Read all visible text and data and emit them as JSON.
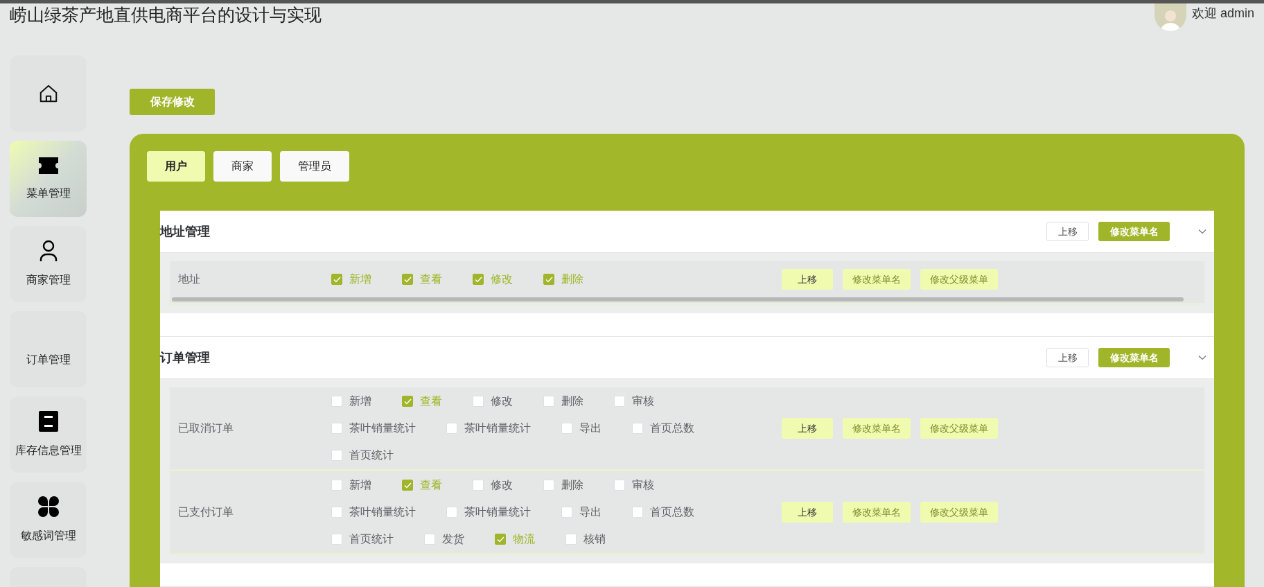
{
  "header": {
    "title": "崂山绿茶产地直供电商平台的设计与实现",
    "greeting": "欢迎 admin"
  },
  "sidebar": {
    "items": [
      {
        "kind": "home",
        "selected": false
      },
      {
        "kind": "ticket",
        "label": "菜单管理",
        "selected": true
      },
      {
        "kind": "person",
        "label": "商家管理",
        "selected": false
      },
      {
        "kind": "none",
        "label": "订单管理",
        "selected": false
      },
      {
        "kind": "drawer",
        "label": "库存信息管理",
        "selected": false
      },
      {
        "kind": "clover",
        "label": "敏感词管理",
        "selected": false
      },
      {
        "kind": "none",
        "selected": false
      }
    ]
  },
  "save_button": "保存修改",
  "tabs": [
    {
      "label": "用户",
      "selected": true
    },
    {
      "label": "商家",
      "selected": false
    },
    {
      "label": "管理员",
      "selected": false
    }
  ],
  "sections": [
    {
      "title": "地址管理",
      "up_button": "上移",
      "rename_button": "修改菜单名",
      "expanded": true,
      "rows": [
        {
          "name": "地址",
          "scrollbar": true,
          "permissions": [
            {
              "label": "新增",
              "checked": true
            },
            {
              "label": "查看",
              "checked": true
            },
            {
              "label": "修改",
              "checked": true
            },
            {
              "label": "删除",
              "checked": true
            }
          ],
          "buttons": [
            {
              "label": "上移",
              "disabled": false
            },
            {
              "label": "修改菜单名",
              "disabled": true
            },
            {
              "label": "修改父级菜单",
              "disabled": true
            }
          ]
        }
      ]
    },
    {
      "title": "订单管理",
      "up_button": "上移",
      "rename_button": "修改菜单名",
      "expanded": true,
      "rows": [
        {
          "name": "已取消订单",
          "scrollbar": false,
          "permissions": [
            {
              "label": "新增",
              "checked": false
            },
            {
              "label": "查看",
              "checked": true
            },
            {
              "label": "修改",
              "checked": false
            },
            {
              "label": "删除",
              "checked": false
            },
            {
              "label": "审核",
              "checked": false
            },
            {
              "label": "茶叶销量统计",
              "checked": false
            },
            {
              "label": "茶叶销量统计",
              "checked": false
            },
            {
              "label": "导出",
              "checked": false
            },
            {
              "label": "首页总数",
              "checked": false
            },
            {
              "label": "首页统计",
              "checked": false
            }
          ],
          "buttons": [
            {
              "label": "上移",
              "disabled": false
            },
            {
              "label": "修改菜单名",
              "disabled": true
            },
            {
              "label": "修改父级菜单",
              "disabled": true
            }
          ]
        },
        {
          "name": "已支付订单",
          "scrollbar": false,
          "permissions": [
            {
              "label": "新增",
              "checked": false
            },
            {
              "label": "查看",
              "checked": true
            },
            {
              "label": "修改",
              "checked": false
            },
            {
              "label": "删除",
              "checked": false
            },
            {
              "label": "审核",
              "checked": false
            },
            {
              "label": "茶叶销量统计",
              "checked": false
            },
            {
              "label": "茶叶销量统计",
              "checked": false
            },
            {
              "label": "导出",
              "checked": false
            },
            {
              "label": "首页总数",
              "checked": false
            },
            {
              "label": "首页统计",
              "checked": false
            },
            {
              "label": "发货",
              "checked": false
            },
            {
              "label": "物流",
              "checked": true
            },
            {
              "label": "核销",
              "checked": false
            }
          ],
          "buttons": [
            {
              "label": "上移",
              "disabled": false
            },
            {
              "label": "修改菜单名",
              "disabled": true
            },
            {
              "label": "修改父级菜单",
              "disabled": true
            }
          ]
        }
      ]
    }
  ]
}
